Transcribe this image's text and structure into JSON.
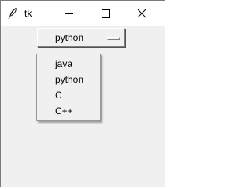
{
  "window": {
    "title": "tk",
    "icon": "feather-icon",
    "controls": {
      "minimize": "minimize-icon",
      "maximize": "maximize-icon",
      "close": "close-icon"
    }
  },
  "option_menu": {
    "selected": "python"
  },
  "dropdown": {
    "items": [
      {
        "label": "java"
      },
      {
        "label": "python"
      },
      {
        "label": "C"
      },
      {
        "label": "C++"
      }
    ]
  },
  "colors": {
    "titlebar": "#ffffff",
    "client_background": "#f0f0f0",
    "text": "#000000"
  }
}
